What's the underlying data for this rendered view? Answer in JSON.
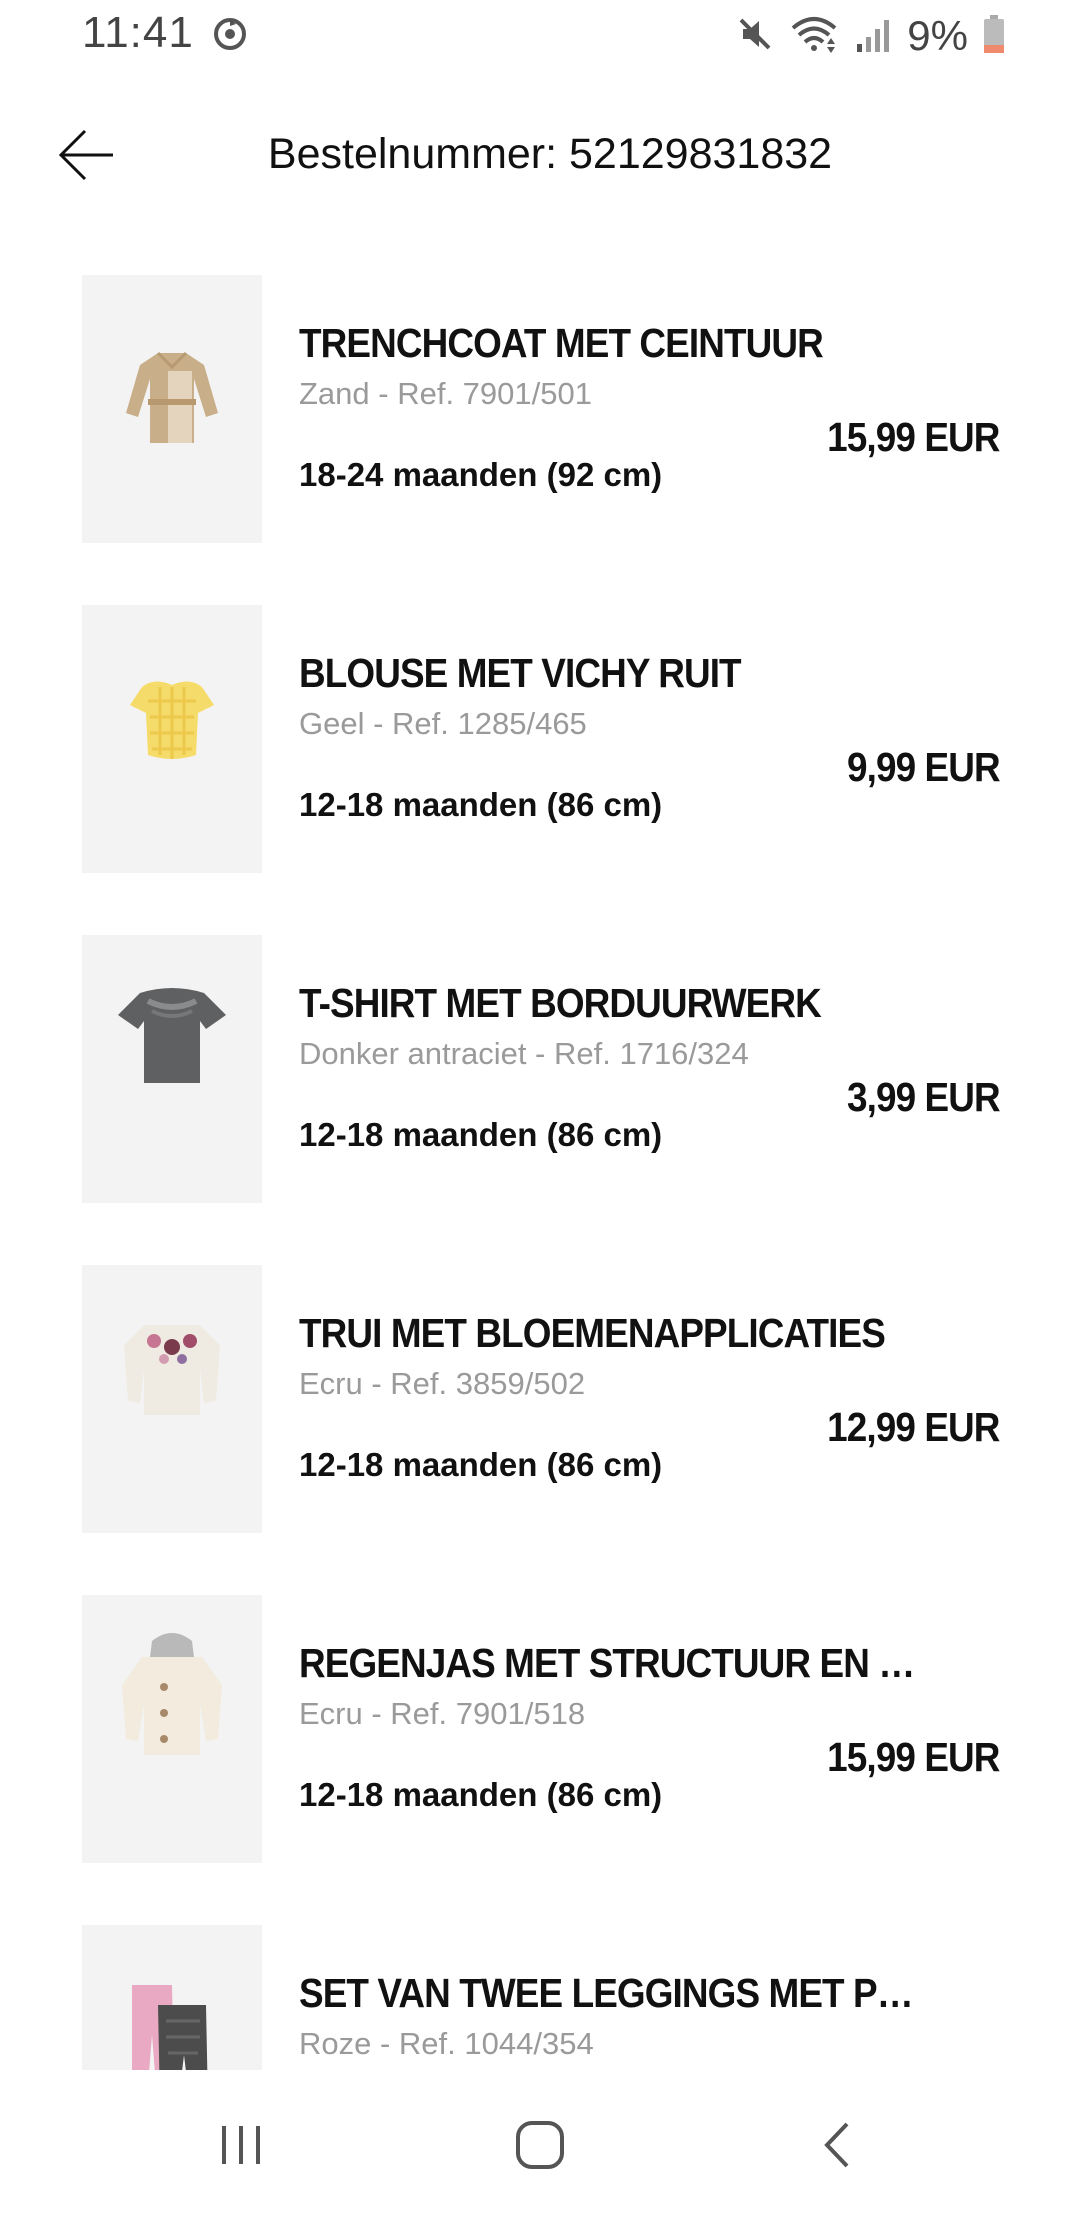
{
  "status_bar": {
    "time": "11:41",
    "battery": "9%",
    "icons": [
      "sync-icon",
      "mute-icon",
      "wifi-icon",
      "signal-icon",
      "battery-icon"
    ],
    "battery_low_color": "#f08a6c"
  },
  "header": {
    "back_icon": "arrow-left-icon",
    "title": "Bestelnummer: 52129831832"
  },
  "items": [
    {
      "name": "TRENCHCOAT MET CEINTUUR",
      "ref": "Zand - Ref. 7901/501",
      "size": "18-24 maanden (92 cm)",
      "price": "15,99 EUR",
      "thumb": "trenchcoat"
    },
    {
      "name": "BLOUSE MET VICHY RUIT",
      "ref": "Geel - Ref. 1285/465",
      "size": "12-18 maanden (86 cm)",
      "price": "9,99 EUR",
      "thumb": "blouse"
    },
    {
      "name": "T-SHIRT MET BORDUURWERK",
      "ref": "Donker antraciet - Ref. 1716/324",
      "size": "12-18 maanden (86 cm)",
      "price": "3,99 EUR",
      "thumb": "tshirt"
    },
    {
      "name": "TRUI MET BLOEMENAPPLICATIES",
      "ref": "Ecru - Ref. 3859/502",
      "size": "12-18 maanden (86 cm)",
      "price": "12,99 EUR",
      "thumb": "sweater"
    },
    {
      "name": "REGENJAS MET STRUCTUUR EN GES…",
      "ref": "Ecru - Ref. 7901/518",
      "size": "12-18 maanden (86 cm)",
      "price": "15,99 EUR",
      "thumb": "raincoat"
    },
    {
      "name": "SET VAN TWEE LEGGINGS MET PRINT",
      "ref": "Roze - Ref. 1044/354",
      "size": "",
      "price": "",
      "thumb": "leggings"
    }
  ],
  "nav_bar": {
    "recents_icon": "recent-apps-icon",
    "home_icon": "home-icon",
    "back_icon": "nav-back-icon"
  }
}
